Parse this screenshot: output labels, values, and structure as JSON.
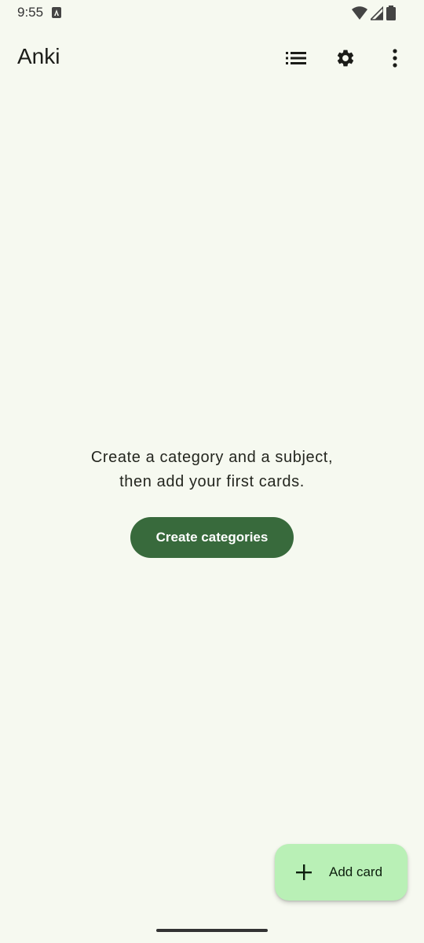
{
  "status_bar": {
    "time": "9:55",
    "icons": [
      "a-notification-icon",
      "wifi-icon",
      "cell-signal-icon",
      "battery-icon"
    ]
  },
  "app_bar": {
    "title": "Anki",
    "actions": [
      "list-icon",
      "settings-gear-icon",
      "more-vert-icon"
    ]
  },
  "empty_state": {
    "line1": "Create a category and a subject,",
    "line2": "then add your first cards.",
    "button_label": "Create categories"
  },
  "fab": {
    "label": "Add card",
    "icon": "plus-icon"
  },
  "colors": {
    "background": "#f6f9f0",
    "primary": "#386a3c",
    "fab_container": "#b9f0b6"
  }
}
